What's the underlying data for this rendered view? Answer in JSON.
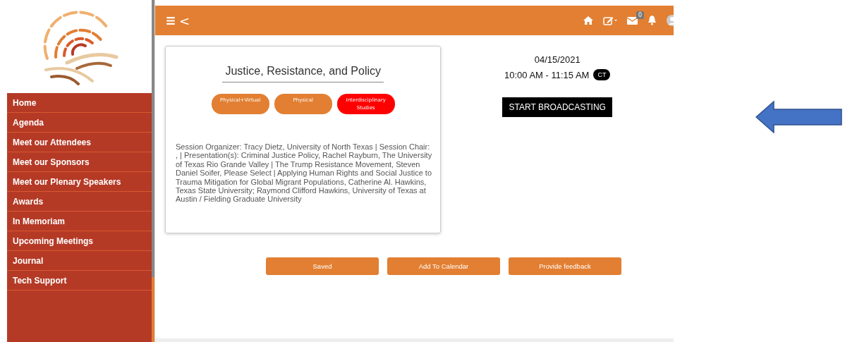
{
  "sidebar": {
    "items": [
      {
        "label": "Home"
      },
      {
        "label": "Agenda"
      },
      {
        "label": "Meet our Attendees"
      },
      {
        "label": "Meet our Sponsors"
      },
      {
        "label": "Meet our Plenary Speakers"
      },
      {
        "label": "Awards"
      },
      {
        "label": "In Memoriam"
      },
      {
        "label": "Upcoming Meetings"
      },
      {
        "label": "Journal"
      },
      {
        "label": "Tech Support"
      }
    ]
  },
  "header": {
    "back": "<",
    "mail_count": "0"
  },
  "session": {
    "title": "Justice, Resistance, and Policy",
    "tags": [
      {
        "label": "Physical+Virtual",
        "color": "#e27f32"
      },
      {
        "label": "Physical",
        "color": "#e27f32"
      },
      {
        "label": "Interdisciplinary Studies",
        "color": "#ff0000"
      }
    ],
    "description": "Session Organizer: Tracy Dietz, University of North Texas | Session Chair: , | Presentation(s): Criminal Justice Policy, Rachel Rayburn, The University of Texas Rio Grande Valley | The Trump Resistance Movement, Steven Daniel Soifer, Please Select | Applying Human Rights and Social Justice to Trauma Mitigation for Global Migrant Populations, Catherine Al. Hawkins, Texas State University; Raymond Clifford Hawkins, University of Texas at Austin / Fielding Graduate University",
    "date": "04/15/2021",
    "time": "10:00 AM - 11:15 AM",
    "timezone": "CT",
    "broadcast_button": "START BROADCASTING"
  },
  "actions": [
    "Saved",
    "Add To Calendar",
    "Provide feedback"
  ]
}
